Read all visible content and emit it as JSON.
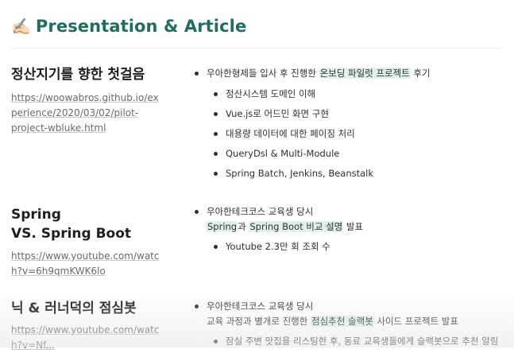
{
  "page": {
    "emoji": "✍🏻",
    "title": "Presentation & Article"
  },
  "sections": [
    {
      "heading": "정산지기를 향한 첫걸음",
      "link_lines": [
        "https://woowabros.github.io/ex",
        "perience/2020/03/02/pilot-",
        "project-wbluke.html"
      ],
      "bullet_pre": "우아한형제들 입사 후 진행한 ",
      "bullet_hl": "온보딩 파일럿 프로젝트",
      "bullet_post": " 후기",
      "sub_items": [
        "정산시스템 도메인 이해",
        "Vue.js로 어드민 화면 구현",
        "대용량 데이터에 대한 페이징 처리",
        "QueryDsl & Multi-Module",
        "Spring Batch, Jenkins, Beanstalk"
      ]
    },
    {
      "heading_line1": "Spring",
      "heading_line2": "VS. Spring Boot",
      "link_lines": [
        "https://www.youtube.com/watc",
        "h?v=6h9qmKWK6lo"
      ],
      "bullet": "우아한테크코스 교육생 당시",
      "line2_hl": "Spring",
      "line2_mid": "과 ",
      "line2_hl2": "Spring Boot 비교 설명",
      "line2_post": " 발표",
      "sub_items": [
        "Youtube 2.3만 회 조회 수"
      ]
    },
    {
      "heading": "닉 & 러너덕의 점심봇",
      "link_lines": [
        "https://www.youtube.com/watc",
        "h?v=Nf..."
      ],
      "bullet": "우아한테크코스 교육생 당시",
      "line2_pre": "교육 과정과 별개로 진행한 ",
      "line2_hl": "점심추천 슬랙봇",
      "line2_post": " 사이드 프로젝트 발표",
      "sub_items": [
        "잠실 주변 맛집을 리스팅한 후, 동료 교육생들에게 슬랙봇으로 추천 알림"
      ]
    }
  ]
}
